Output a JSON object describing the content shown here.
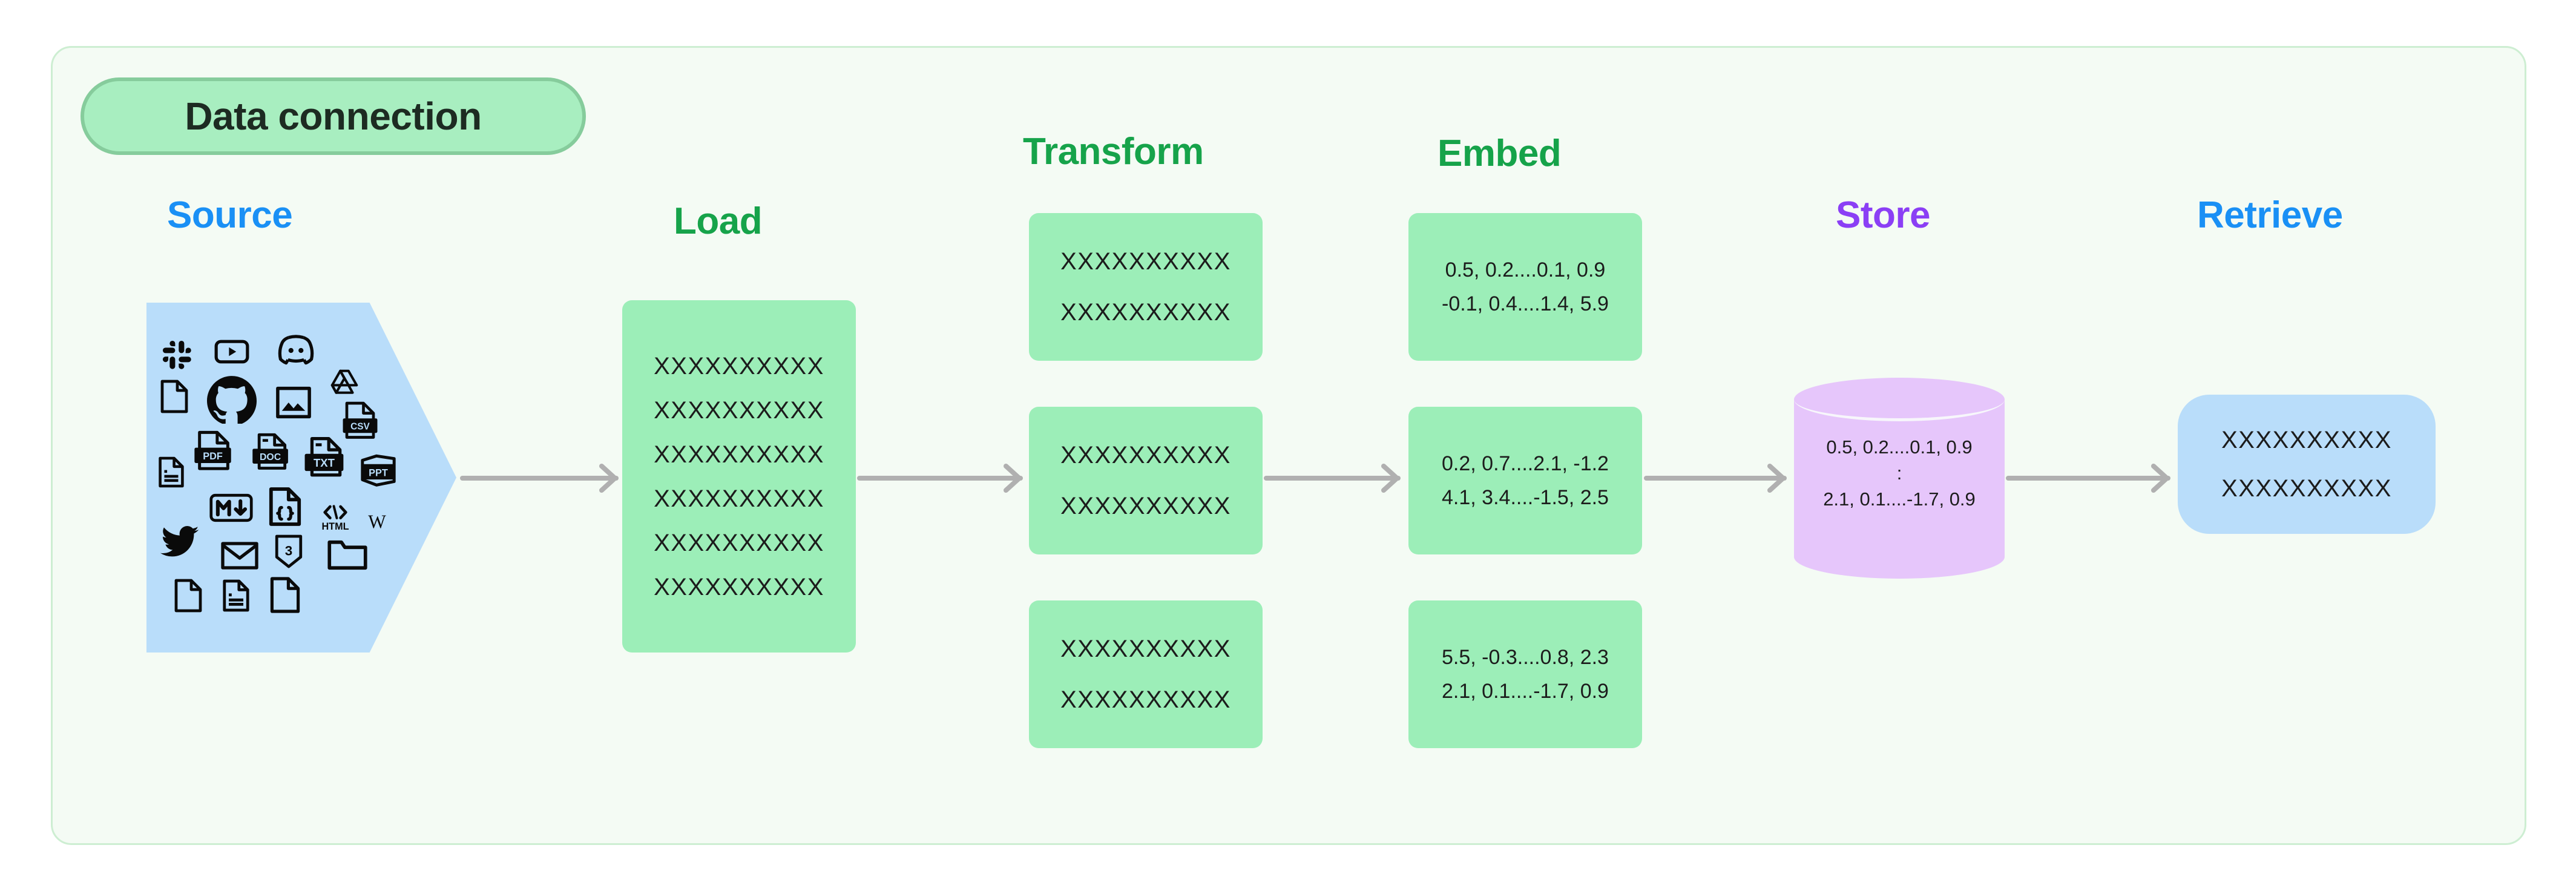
{
  "badge": {
    "label": "Data connection"
  },
  "colors": {
    "panel_bg": "#f4fbf4",
    "panel_border": "#cdeed2",
    "badge_bg": "#a8eec0",
    "badge_border": "#86cc9c",
    "blue_heading": "#1a90f5",
    "green_heading": "#16a34a",
    "purple_heading": "#8b3ff5",
    "source_fill": "#b9ddfa",
    "card_green": "#9ceeb8",
    "cylinder_purple": "#e6c6fb",
    "arrow_grey": "#b0b0b0",
    "text_dark": "#1c1c1c"
  },
  "headings": {
    "source": "Source",
    "load": "Load",
    "transform": "Transform",
    "embed": "Embed",
    "store": "Store",
    "retrieve": "Retrieve"
  },
  "source": {
    "icons": [
      "slack-icon",
      "youtube-icon",
      "discord-icon",
      "file-blank-icon",
      "github-icon",
      "image-icon",
      "google-drive-icon",
      "csv-file-icon",
      "document-lines-icon",
      "pdf-file-icon",
      "doc-file-icon",
      "txt-file-icon",
      "ppt-file-icon",
      "markdown-icon",
      "json-code-file-icon",
      "html-icon",
      "wikipedia-icon",
      "twitter-icon",
      "email-icon",
      "css3-icon",
      "folder-icon",
      "file-blank-2-icon",
      "document-lines-2-icon",
      "file-blank-3-icon"
    ]
  },
  "load": {
    "lines": [
      "XXXXXXXXXX",
      "XXXXXXXXXX",
      "XXXXXXXXXX",
      "XXXXXXXXXX",
      "XXXXXXXXXX",
      "XXXXXXXXXX"
    ]
  },
  "transform": {
    "cards": [
      {
        "lines": [
          "XXXXXXXXXX",
          "XXXXXXXXXX"
        ]
      },
      {
        "lines": [
          "XXXXXXXXXX",
          "XXXXXXXXXX"
        ]
      },
      {
        "lines": [
          "XXXXXXXXXX",
          "XXXXXXXXXX"
        ]
      }
    ]
  },
  "embed": {
    "cards": [
      {
        "lines": [
          "0.5, 0.2....0.1, 0.9",
          "-0.1, 0.4....1.4, 5.9"
        ]
      },
      {
        "lines": [
          "0.2, 0.7....2.1, -1.2",
          "4.1, 3.4....-1.5, 2.5"
        ]
      },
      {
        "lines": [
          "5.5, -0.3....0.8, 2.3",
          "2.1, 0.1....-1.7, 0.9"
        ]
      }
    ]
  },
  "store": {
    "lines": [
      "0.5, 0.2....0.1, 0.9",
      ":",
      "2.1, 0.1....-1.7, 0.9"
    ]
  },
  "retrieve": {
    "lines": [
      "XXXXXXXXXX",
      "XXXXXXXXXX"
    ]
  },
  "arrows": {
    "count": 5,
    "direction": "right"
  }
}
